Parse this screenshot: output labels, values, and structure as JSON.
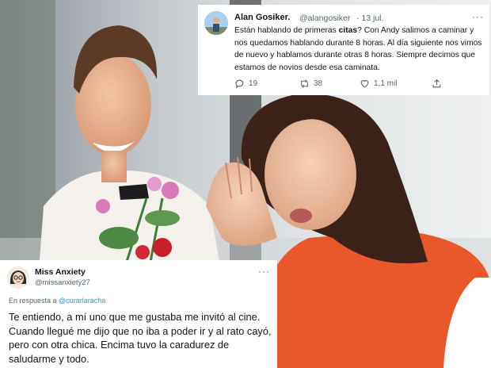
{
  "tweet_top": {
    "name": "Alan Gosiker.",
    "handle": "@alangosiker",
    "date": "· 13 jul.",
    "more": "···",
    "text_before": "Están hablando de primeras ",
    "text_bold": "citas",
    "text_after": "? Con Andy salimos a caminar y nos quedamos hablando durante 8 horas. Al día siguiente nos vimos de nuevo y hablamos durante otras 8 horas. Siempre decimos que estamos de novios desde esa caminata.",
    "replies": "19",
    "retweets": "38",
    "likes": "1,1 mil"
  },
  "tweet_bottom": {
    "name": "Miss Anxiety",
    "handle": "@missanxiety27",
    "more": "···",
    "reply_prefix": "En respuesta a ",
    "reply_to": "@curarlaracha",
    "text": "Te entiendo, a mí uno que me gustaba me invitó al cine. Cuando llegué me dijo que no iba a poder ir y al rato cayó, pero con otra chica. Encima tuvo la caradurez de saludarme y todo."
  },
  "colors": {
    "link": "#1d9bf0",
    "secondary": "#536471",
    "text": "#0f1419"
  }
}
